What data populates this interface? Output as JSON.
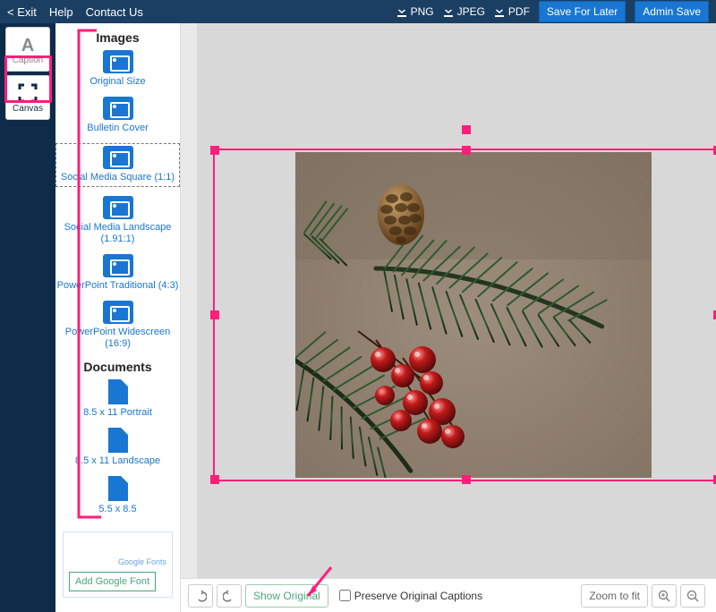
{
  "topbar": {
    "exit": "< Exit",
    "help": "Help",
    "contact": "Contact Us",
    "download_png": "PNG",
    "download_jpeg": "JPEG",
    "download_pdf": "PDF",
    "save_later": "Save For Later",
    "admin_save": "Admin Save"
  },
  "rail": {
    "caption": "Caption",
    "canvas": "Canvas"
  },
  "side": {
    "images_title": "Images",
    "documents_title": "Documents",
    "img_options": [
      "Original Size",
      "Bulletin Cover",
      "Social Media Square (1:1)",
      "Social Media Landscape (1.91:1)",
      "PowerPoint Traditional (4:3)",
      "PowerPoint Widescreen (16:9)"
    ],
    "doc_options": [
      "8.5 x 11 Portrait",
      "8.5 x 11 Landscape",
      "5.5 x 8.5"
    ],
    "google_fonts": "Google Fonts",
    "add_google_font": "Add Google Font"
  },
  "bottom": {
    "show_original": "Show Original",
    "preserve": "Preserve Original Captions",
    "zoom_fit": "Zoom to fit"
  }
}
